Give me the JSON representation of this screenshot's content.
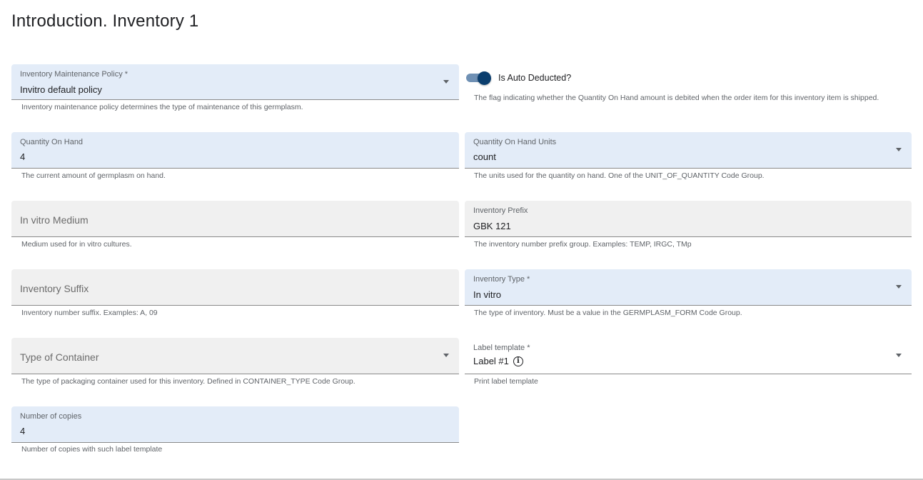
{
  "page": {
    "title": "Introduction. Inventory 1"
  },
  "fields": {
    "maintenance_policy": {
      "label": "Inventory Maintenance Policy *",
      "value": "Invitro default policy",
      "hint": "Inventory maintenance policy determines the type of maintenance of this germplasm."
    },
    "auto_deducted": {
      "label": "Is Auto Deducted?",
      "checked": true,
      "hint": "The flag indicating whether the Quantity On Hand amount is debited when the order item for this inventory item is shipped."
    },
    "quantity_on_hand": {
      "label": "Quantity On Hand",
      "value": "4",
      "hint": "The current amount of germplasm on hand."
    },
    "quantity_units": {
      "label": "Quantity On Hand Units",
      "value": "count",
      "hint": "The units used for the quantity on hand. One of the UNIT_OF_QUANTITY Code Group."
    },
    "in_vitro_medium": {
      "placeholder": "In vitro Medium",
      "hint": "Medium used for in vitro cultures."
    },
    "inventory_prefix": {
      "label": "Inventory Prefix",
      "value": "GBK 121",
      "hint": "The inventory number prefix group. Examples: TEMP, IRGC, TMp"
    },
    "inventory_suffix": {
      "placeholder": "Inventory Suffix",
      "hint": "Inventory number suffix. Examples: A, 09"
    },
    "inventory_type": {
      "label": "Inventory Type *",
      "value": "In vitro",
      "hint": "The type of inventory. Must be a value in the GERMPLASM_FORM Code Group."
    },
    "container_type": {
      "placeholder": "Type of Container",
      "hint": "The type of packaging container used for this inventory. Defined in CONTAINER_TYPE Code Group."
    },
    "label_template": {
      "label": "Label template *",
      "value": "Label #1",
      "hint": "Print label template"
    },
    "number_of_copies": {
      "label": "Number of copies",
      "value": "4",
      "hint": "Number of copies with such label template"
    }
  },
  "icons": {
    "info": "info-icon",
    "dropdown": "chevron-down-icon"
  },
  "colors": {
    "active_field": "#e3ecf8",
    "inactive_field": "#f0f0f0",
    "toggle_on": "#0b3e6e"
  }
}
